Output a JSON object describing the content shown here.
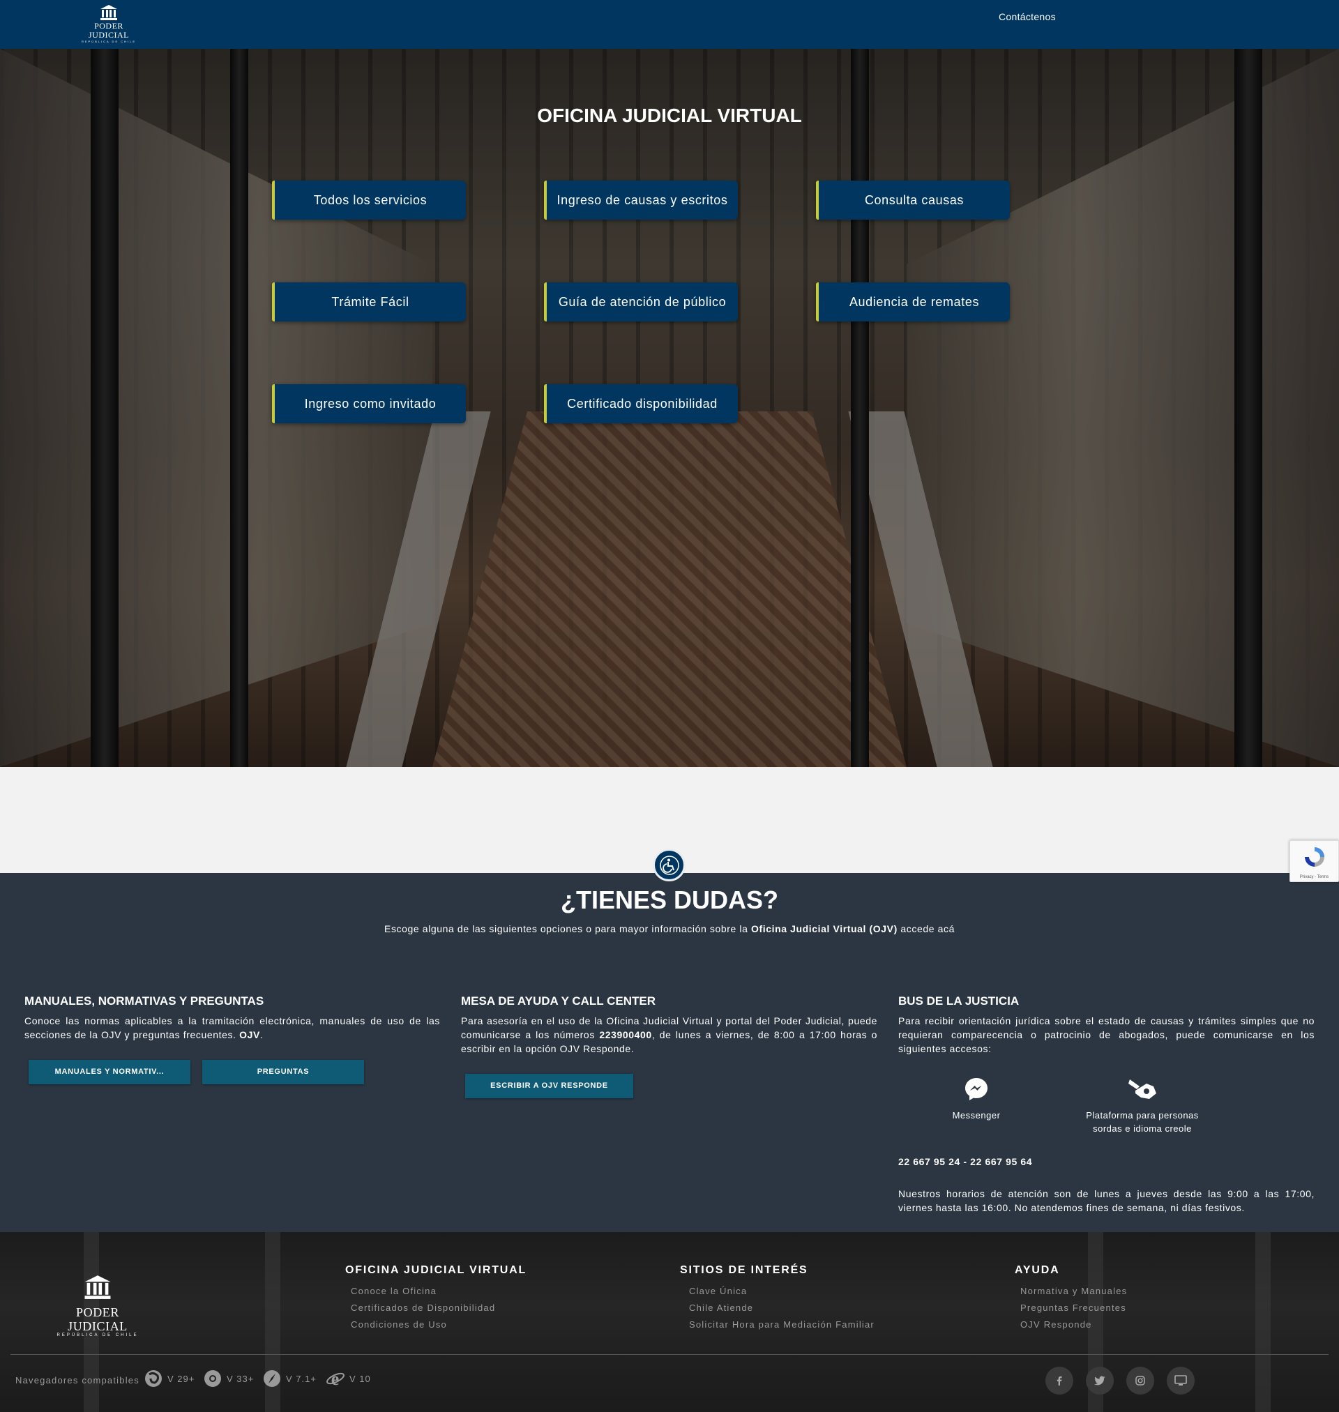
{
  "header": {
    "logo": {
      "line1": "PODER JUDICIAL",
      "line2": "REPÚBLICA DE CHILE"
    },
    "nav_contact": "Contáctenos"
  },
  "hero": {
    "title": "OFICINA JUDICIAL VIRTUAL",
    "services": [
      "Todos los servicios",
      "Ingreso de causas y escritos",
      "Consulta causas",
      "Trámite Fácil",
      "Guía de atención de público",
      "Audiencia de remates",
      "Ingreso como invitado",
      "Certificado disponibilidad"
    ]
  },
  "accessibility": {
    "icon": "wheelchair-icon"
  },
  "recaptcha": {
    "text": "Privacy - Terms"
  },
  "dudas": {
    "title": "¿TIENES DUDAS?",
    "subtitle_pre": "Escoge alguna de las siguientes opciones o para mayor información sobre la ",
    "subtitle_bold": "Oficina Judicial Virtual (OJV)",
    "subtitle_post": " accede acá",
    "manuales": {
      "title": "MANUALES, NORMATIVAS Y PREGUNTAS",
      "text": "Conoce las normas aplicables a la tramitación electrónica, manuales de uso de las secciones de la OJV y preguntas frecuentes. ",
      "text_bold": "OJV",
      "text_end": ".",
      "btn_manuales": "MANUALES Y NORMATIV...",
      "btn_preguntas": "PREGUNTAS"
    },
    "mesa": {
      "title": "MESA DE AYUDA Y CALL CENTER",
      "text_pre": "Para asesoría en el uso de la Oficina Judicial Virtual y portal del Poder Judicial, puede comunicarse a los números ",
      "phone": "223900400",
      "text_post": ", de lunes a viernes, de 8:00 a 17:00 horas o escribir en la opción OJV Responde.",
      "btn": "ESCRIBIR A OJV RESPONDE"
    },
    "bus": {
      "title": "BUS DE LA JUSTICIA",
      "text": "Para recibir orientación jurídica sobre el estado de causas y trámites simples que no requieran comparecencia o patrocinio de abogados, puede comunicarse en los siguientes accesos:",
      "messenger": "Messenger",
      "sign_line1": "Plataforma para personas",
      "sign_line2": "sordas e idioma creole",
      "phones": "22 667 95 24 - 22 667 95 64",
      "hours": "Nuestros horarios de atención son de lunes a jueves desde las 9:00 a las 17:00, viernes hasta las 16:00. No atendemos fines de semana, ni días festivos."
    }
  },
  "footer": {
    "logo": {
      "line1": "PODER JUDICIAL",
      "line2": "REPÚBLICA DE CHILE"
    },
    "col1": {
      "title": "OFICINA JUDICIAL VIRTUAL",
      "links": [
        "Conoce la Oficina",
        "Certificados de Disponibilidad",
        "Condiciones de Uso"
      ]
    },
    "col2": {
      "title": "SITIOS DE INTERÉS",
      "links": [
        "Clave Única",
        "Chile Atiende",
        "Solicitar Hora para Mediación Familiar"
      ]
    },
    "col3": {
      "title": "AYUDA",
      "links": [
        "Normativa y Manuales",
        "Preguntas Frecuentes",
        "OJV Responde"
      ]
    },
    "browsers_label": "Navegadores compatibles",
    "browsers": [
      {
        "icon": "firefox-icon",
        "version": "V 29+"
      },
      {
        "icon": "chrome-icon",
        "version": "V 33+"
      },
      {
        "icon": "safari-icon",
        "version": "V 7.1+"
      },
      {
        "icon": "ie-icon",
        "version": "V 10"
      }
    ],
    "social": [
      "facebook-icon",
      "twitter-icon",
      "instagram-icon",
      "monitor-icon"
    ]
  },
  "colors": {
    "header_bg": "#00365f",
    "button_accent": "#c6cc3b",
    "dudas_bg": "#2c3642",
    "help_button": "#0f5b75"
  }
}
